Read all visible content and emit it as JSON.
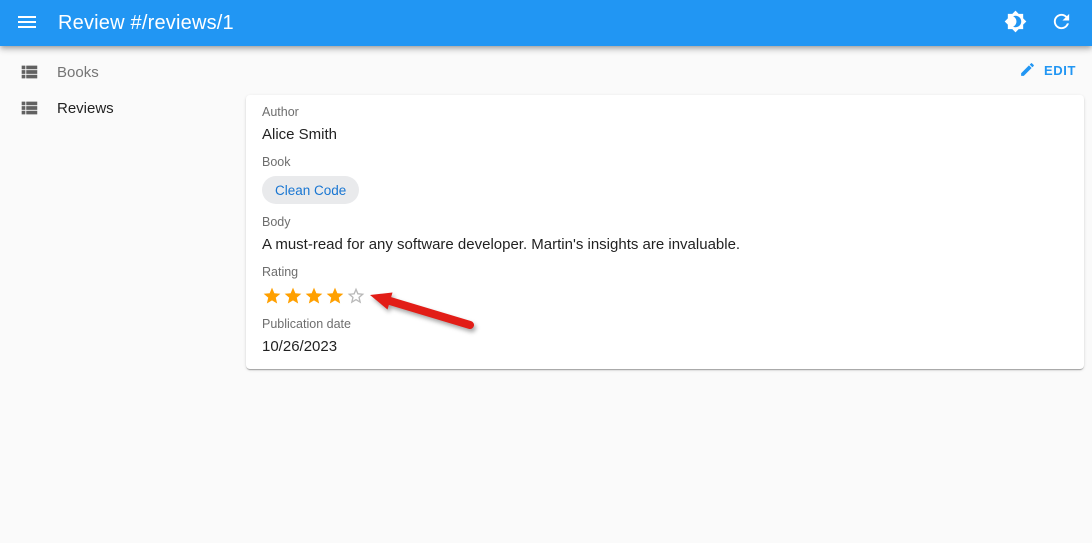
{
  "app_bar": {
    "title": "Review #/reviews/1",
    "menu_icon": "menu-icon",
    "theme_icon": "dark-mode-toggle-icon",
    "refresh_icon": "refresh-icon"
  },
  "sidebar": {
    "items": [
      {
        "label": "Books",
        "active": false
      },
      {
        "label": "Reviews",
        "active": true
      }
    ]
  },
  "toolbar": {
    "edit_label": "EDIT"
  },
  "detail": {
    "author": {
      "label": "Author",
      "value": "Alice Smith"
    },
    "book": {
      "label": "Book",
      "value": "Clean Code"
    },
    "body": {
      "label": "Body",
      "value": "A must-read for any software developer. Martin's insights are invaluable."
    },
    "rating": {
      "label": "Rating",
      "value": 4,
      "max": 5
    },
    "publication_date": {
      "label": "Publication date",
      "value": "10/26/2023"
    }
  },
  "annotation": {
    "type": "arrow",
    "points_at": "rating-stars"
  },
  "colors": {
    "app_bar": "#2196f3",
    "accent": "#2196f3",
    "chip_text": "#1976d2",
    "star_filled": "#FFA000",
    "star_empty": "#b9b9b9",
    "arrow": "#e21d17",
    "background": "#fafafa"
  }
}
